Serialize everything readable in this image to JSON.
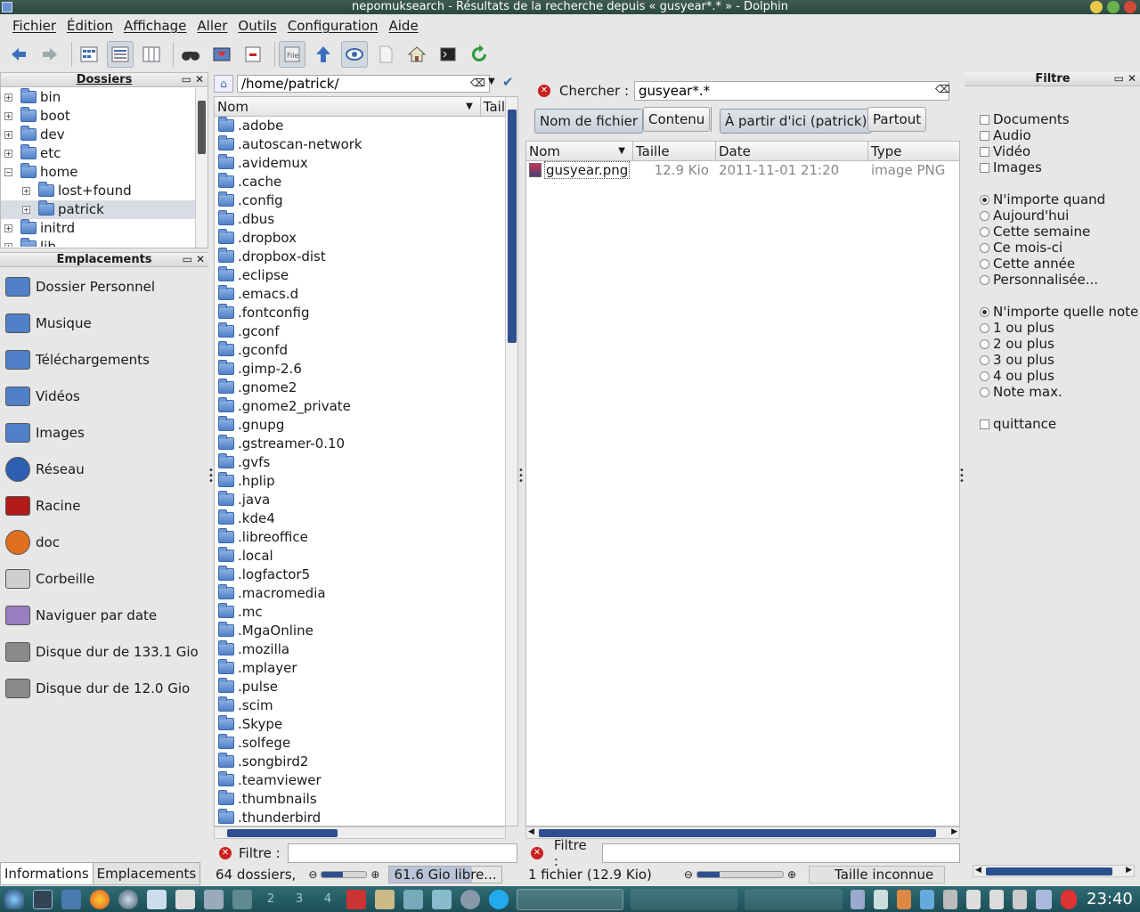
{
  "window": {
    "title": "nepomuksearch - Résultats de la recherche depuis « gusyear*.* » - Dolphin"
  },
  "menu": [
    "Fichier",
    "Édition",
    "Affichage",
    "Aller",
    "Outils",
    "Configuration",
    "Aide"
  ],
  "toolbar": [
    "back-icon",
    "forward-icon",
    "icons-view-icon",
    "details-view-icon",
    "columns-view-icon",
    "find-icon",
    "preview-icon",
    "split-icon",
    "file-icon",
    "up-icon",
    "eye-icon",
    "new-doc-icon",
    "home-icon",
    "terminal-icon",
    "reload-icon"
  ],
  "folders": {
    "title": "Dossiers",
    "items": [
      "bin",
      "boot",
      "dev",
      "etc",
      "home",
      "lost+found",
      "patrick",
      "initrd",
      "lib"
    ]
  },
  "places": {
    "title": "Emplacements",
    "items": [
      {
        "label": "Dossier Personnel",
        "icon": "home-folder-icon"
      },
      {
        "label": "Musique",
        "icon": "music-folder-icon"
      },
      {
        "label": "Téléchargements",
        "icon": "download-folder-icon"
      },
      {
        "label": "Vidéos",
        "icon": "video-folder-icon"
      },
      {
        "label": "Images",
        "icon": "image-folder-icon"
      },
      {
        "label": "Réseau",
        "icon": "network-icon"
      },
      {
        "label": "Racine",
        "icon": "root-folder-icon"
      },
      {
        "label": "doc",
        "icon": "doc-icon"
      },
      {
        "label": "Corbeille",
        "icon": "trash-icon"
      },
      {
        "label": "Naviguer par date",
        "icon": "timeline-icon"
      },
      {
        "label": "Disque dur de 133.1 Gio",
        "icon": "harddisk-icon"
      },
      {
        "label": "Disque dur de 12.0 Gio",
        "icon": "harddisk-icon"
      }
    ]
  },
  "left_tabs": [
    "Informations",
    "Emplacements"
  ],
  "left_pane": {
    "path": "/home/patrick/",
    "col_name": "Nom",
    "col_size": "Tail",
    "files": [
      ".adobe",
      ".autoscan-network",
      ".avidemux",
      ".cache",
      ".config",
      ".dbus",
      ".dropbox",
      ".dropbox-dist",
      ".eclipse",
      ".emacs.d",
      ".fontconfig",
      ".gconf",
      ".gconfd",
      ".gimp-2.6",
      ".gnome2",
      ".gnome2_private",
      ".gnupg",
      ".gstreamer-0.10",
      ".gvfs",
      ".hplip",
      ".java",
      ".kde4",
      ".libreoffice",
      ".local",
      ".logfactor5",
      ".macromedia",
      ".mc",
      ".MgaOnline",
      ".mozilla",
      ".mplayer",
      ".pulse",
      ".scim",
      ".Skype",
      ".solfege",
      ".songbird2",
      ".teamviewer",
      ".thumbnails",
      ".thunderbird"
    ],
    "filter_label": "Filtre :",
    "status": "64 dossiers,",
    "free": "61.6 Gio libre..."
  },
  "search": {
    "label": "Chercher :",
    "value": "gusyear*.*",
    "btn_filename": "Nom de fichier",
    "btn_content": "Contenu",
    "btn_from_here": "À partir d'ici (patrick)",
    "btn_everywhere": "Partout"
  },
  "right_pane": {
    "cols": [
      "Nom",
      "Taille",
      "Date",
      "Type"
    ],
    "rows": [
      {
        "name": "gusyear.png",
        "size": "12.9 Kio",
        "date": "2011-11-01 21:20",
        "type": "image PNG"
      }
    ],
    "filter_label": "Filtre :",
    "status": "1 fichier (12.9 Kio)",
    "size_status": "Taille inconnue"
  },
  "filter_panel": {
    "title": "Filtre",
    "types": [
      "Documents",
      "Audio",
      "Vidéo",
      "Images"
    ],
    "dates": [
      "N'importe quand",
      "Aujourd'hui",
      "Cette semaine",
      "Ce mois-ci",
      "Cette année",
      "Personnalisée..."
    ],
    "ratings": [
      "N'importe quelle note",
      "1 ou plus",
      "2 ou plus",
      "3 ou plus",
      "4 ou plus",
      "Note max."
    ],
    "tags": [
      "quittance"
    ]
  },
  "taskbar": {
    "clock": "23:40",
    "desktops": [
      "2",
      "3",
      "4"
    ]
  },
  "colors": {
    "accent": "#3b68ad",
    "titlebar": "#2b4a42",
    "taskbar": "#1e4f57",
    "selection": "#c9d4e3"
  }
}
